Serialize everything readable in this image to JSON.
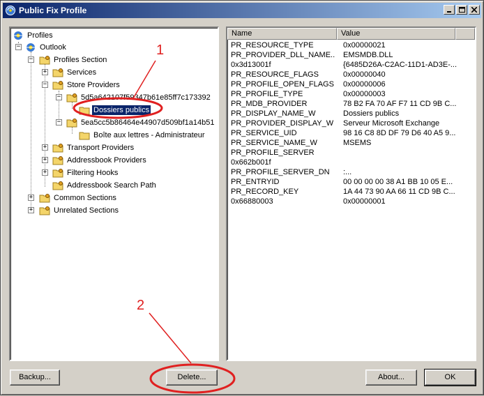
{
  "window": {
    "title": "Public Fix Profile"
  },
  "tree": {
    "nodes": [
      {
        "label": "Profiles"
      },
      {
        "label": "Outlook"
      },
      {
        "label": "Profiles Section"
      },
      {
        "label": "Services"
      },
      {
        "label": "Store Providers"
      },
      {
        "label": "5d5a642107f59347b61e85ff7c173392"
      },
      {
        "label": "Dossiers publics"
      },
      {
        "label": "5ea5cc5b86464e44907d509bf1a14b51"
      },
      {
        "label": "Boîte aux lettres - Administrateur"
      },
      {
        "label": "Transport Providers"
      },
      {
        "label": "Addressbook Providers"
      },
      {
        "label": "Filtering Hooks"
      },
      {
        "label": "Addressbook Search Path"
      },
      {
        "label": "Common Sections"
      },
      {
        "label": "Unrelated Sections"
      }
    ]
  },
  "list": {
    "columns": [
      "Name",
      "Value"
    ],
    "rows": [
      {
        "name": "PR_RESOURCE_TYPE",
        "value": "0x00000021"
      },
      {
        "name": "PR_PROVIDER_DLL_NAME...",
        "value": "EMSMDB.DLL"
      },
      {
        "name": "0x3d13001f",
        "value": "{6485D26A-C2AC-11D1-AD3E-..."
      },
      {
        "name": "PR_RESOURCE_FLAGS",
        "value": "0x00000040"
      },
      {
        "name": "PR_PROFILE_OPEN_FLAGS",
        "value": "0x00000006"
      },
      {
        "name": "PR_PROFILE_TYPE",
        "value": "0x00000003"
      },
      {
        "name": "PR_MDB_PROVIDER",
        "value": "78 B2 FA 70 AF F7 11 CD 9B C..."
      },
      {
        "name": "PR_DISPLAY_NAME_W",
        "value": "Dossiers publics"
      },
      {
        "name": "PR_PROVIDER_DISPLAY_W",
        "value": "Serveur Microsoft Exchange"
      },
      {
        "name": "PR_SERVICE_UID",
        "value": "98 16 C8 8D DF 79 D6 40 A5 9..."
      },
      {
        "name": "PR_SERVICE_NAME_W",
        "value": "MSEMS"
      },
      {
        "name": "PR_PROFILE_SERVER",
        "value": ""
      },
      {
        "name": "0x662b001f",
        "value": ""
      },
      {
        "name": "PR_PROFILE_SERVER_DN",
        "value": ":..."
      },
      {
        "name": "PR_ENTRYID",
        "value": "00 00 00 00 38 A1 BB 10 05 E..."
      },
      {
        "name": "PR_RECORD_KEY",
        "value": "1A 44 73 90 AA 66 11 CD 9B C..."
      },
      {
        "name": "0x66880003",
        "value": "0x00000001"
      }
    ]
  },
  "buttons": {
    "backup": "Backup...",
    "delete": "Delete...",
    "about": "About...",
    "ok": "OK"
  },
  "annotations": {
    "label_1": "1",
    "label_2": "2",
    "color": "#e02020"
  },
  "colors": {
    "selection": "#0a246a",
    "dialog": "#d4d0c8"
  }
}
